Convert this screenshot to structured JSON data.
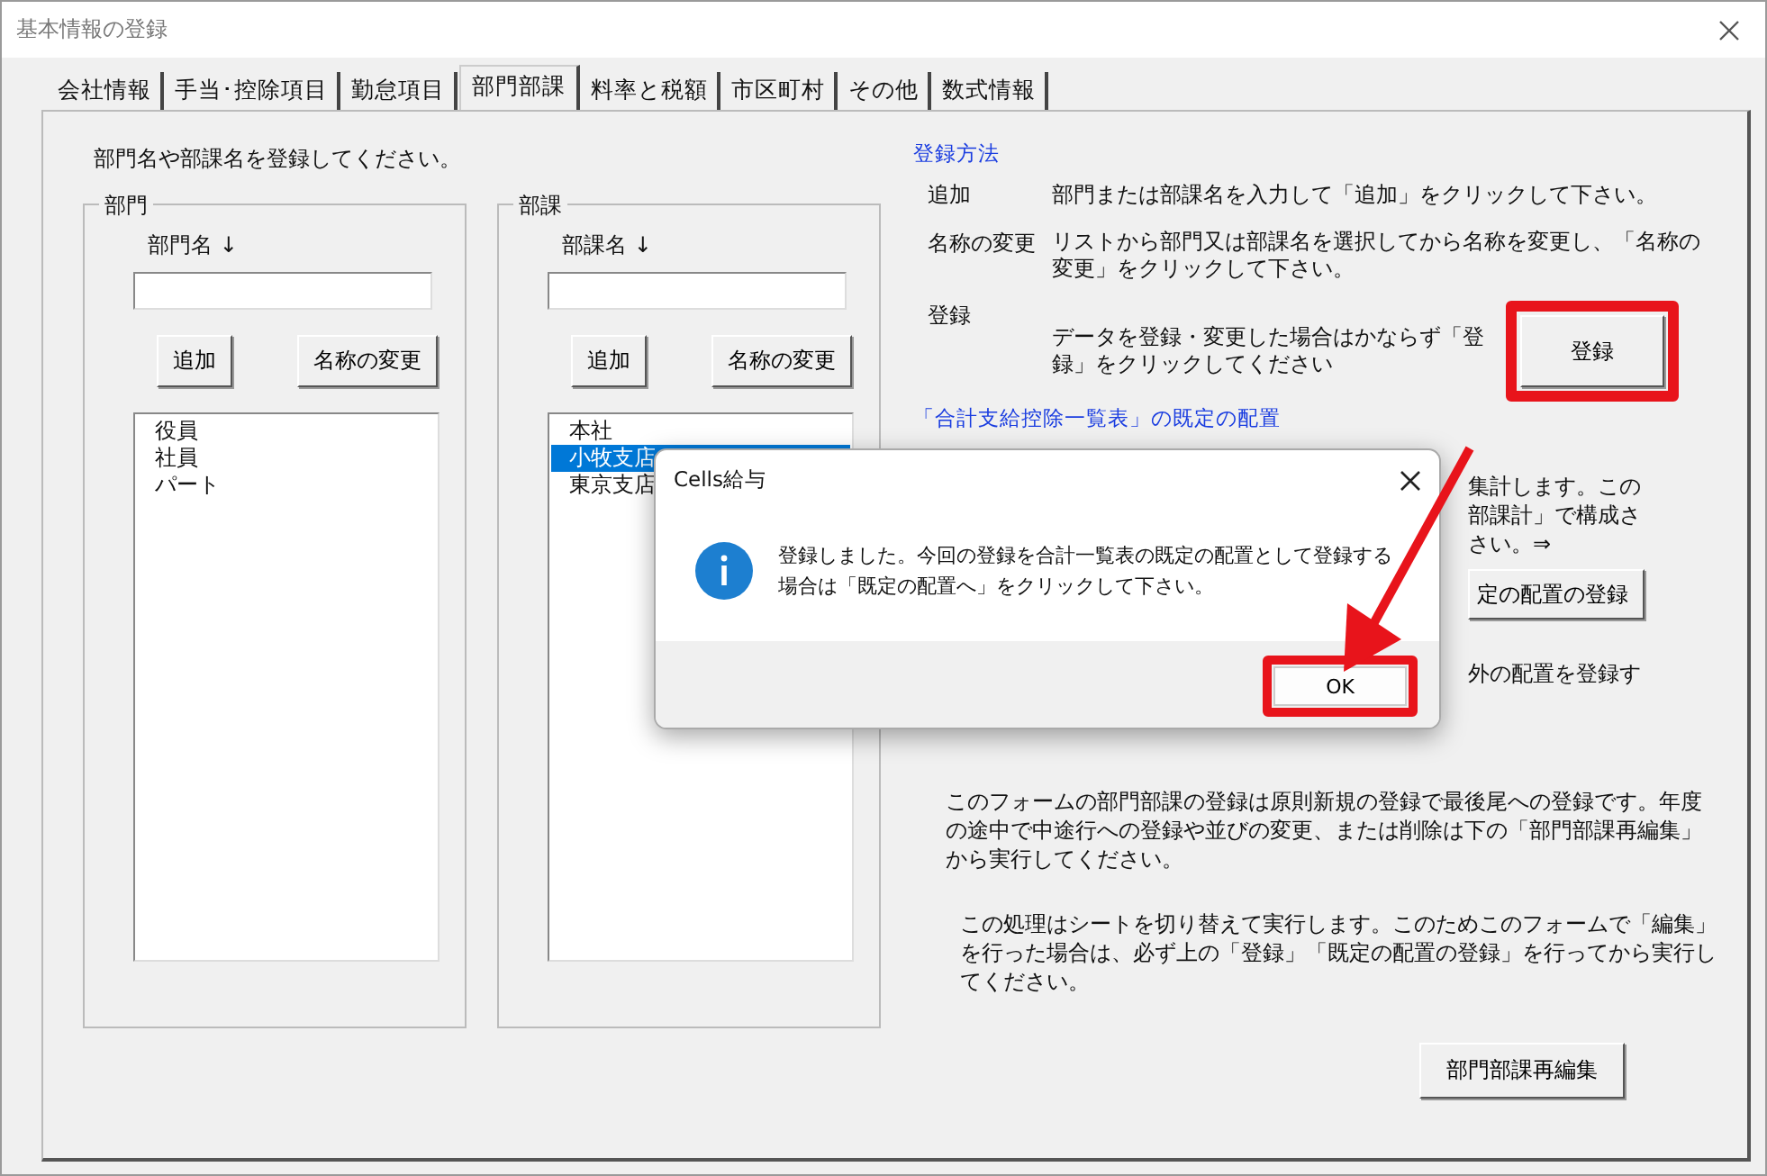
{
  "window": {
    "title": "基本情報の登録"
  },
  "tabs": [
    {
      "label": "会社情報",
      "selected": false
    },
    {
      "label": "手当･控除項目",
      "selected": false
    },
    {
      "label": "勤怠項目",
      "selected": false
    },
    {
      "label": "部門部課",
      "selected": true
    },
    {
      "label": "料率と税額",
      "selected": false
    },
    {
      "label": "市区町村",
      "selected": false
    },
    {
      "label": "その他",
      "selected": false
    },
    {
      "label": "数式情報",
      "selected": false
    }
  ],
  "instruction": "部門名や部課名を登録してください。",
  "groups": [
    {
      "title": "部門",
      "field_label": "部門名 ↓",
      "buttons": [
        "追加",
        "名称の変更"
      ],
      "items": [
        {
          "label": "役員",
          "selected": false
        },
        {
          "label": "社員",
          "selected": false
        },
        {
          "label": "パート",
          "selected": false
        }
      ]
    },
    {
      "title": "部課",
      "field_label": "部課名 ↓",
      "buttons": [
        "追加",
        "名称の変更"
      ],
      "items": [
        {
          "label": "本社",
          "selected": false
        },
        {
          "label": "小牧支店",
          "selected": true
        },
        {
          "label": "東京支店",
          "selected": false
        }
      ]
    }
  ],
  "help": {
    "heading": "登録方法",
    "steps": [
      {
        "term": "追加",
        "text": "部門または部課名を入力して「追加」をクリックして下さい。"
      },
      {
        "term": "名称の変更",
        "text": "リストから部門又は部課名を選択してから名称を変更し、「名称の変更」をクリックして下さい。"
      },
      {
        "term": "登録",
        "text": "データを登録・変更した場合はかならず「登録」をクリックしてください",
        "button": "登録"
      }
    ],
    "layout_link": "「合計支給控除一覧表」の既定の配置",
    "partial_lines": [
      "集計します。この",
      "部課計」で構成さ",
      "さい。⇒"
    ],
    "partial_button": "定の配置の登録",
    "partial_line": "外の配置を登録す",
    "paragraphs": [
      "このフォームの部門部課の登録は原則新規の登録で最後尾への登録です。年度の途中で中途行への登録や並びの変更、または削除は下の「部門部課再編集」から実行してください。",
      "この処理はシートを切り替えて実行します。このためこのフォームで「編集」を行った場合は、必ず上の「登録」「既定の配置の登録」を行ってから実行してください。"
    ],
    "reedit_button": "部門部課再編集"
  },
  "dialog": {
    "title": "Cells給与",
    "message": "登録しました。今回の登録を合計一覧表の既定の配置として登録する場合は「既定の配置へ」をクリックして下さい。",
    "ok": "OK"
  }
}
